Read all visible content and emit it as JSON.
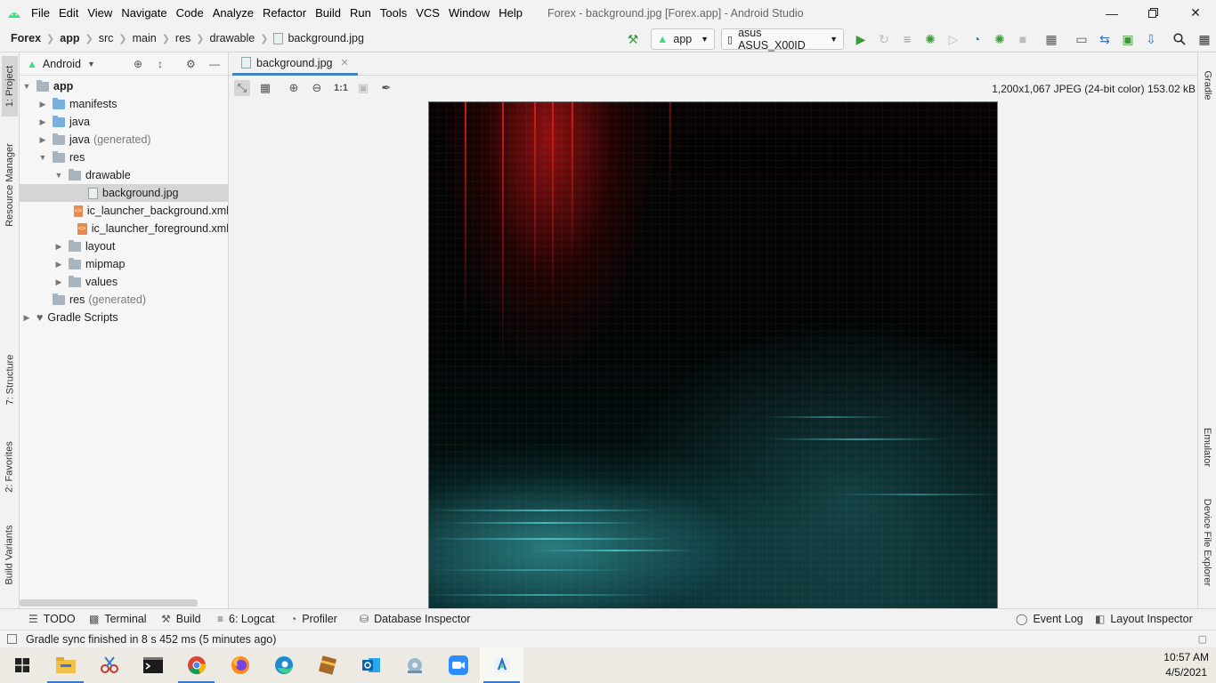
{
  "window": {
    "title": "Forex - background.jpg [Forex.app] - Android Studio",
    "menu": [
      "File",
      "Edit",
      "View",
      "Navigate",
      "Code",
      "Analyze",
      "Refactor",
      "Build",
      "Run",
      "Tools",
      "VCS",
      "Window",
      "Help"
    ]
  },
  "breadcrumb": [
    "Forex",
    "app",
    "src",
    "main",
    "res",
    "drawable",
    "background.jpg"
  ],
  "run_config": {
    "module": "app",
    "device": "asus ASUS_X00ID"
  },
  "left_strip": [
    "1: Project",
    "Resource Manager",
    "7: Structure",
    "2: Favorites",
    "Build Variants"
  ],
  "right_strip": [
    "Gradle",
    "Emulator",
    "Device File Explorer"
  ],
  "project_panel": {
    "view_mode": "Android",
    "tree": [
      {
        "label": "app",
        "bold": true,
        "depth": 0
      },
      {
        "label": "manifests",
        "depth": 1
      },
      {
        "label": "java",
        "depth": 1
      },
      {
        "label": "java",
        "suffix": "(generated)",
        "depth": 1
      },
      {
        "label": "res",
        "depth": 1
      },
      {
        "label": "drawable",
        "depth": 2
      },
      {
        "label": "background.jpg",
        "depth": 3,
        "selected": true
      },
      {
        "label": "ic_launcher_background.xml",
        "depth": 3
      },
      {
        "label": "ic_launcher_foreground.xml",
        "depth": 3
      },
      {
        "label": "layout",
        "depth": 2
      },
      {
        "label": "mipmap",
        "depth": 2
      },
      {
        "label": "values",
        "depth": 2
      },
      {
        "label": "res",
        "suffix": "(generated)",
        "depth": 1
      },
      {
        "label": "Gradle Scripts",
        "depth": 0
      }
    ]
  },
  "editor": {
    "tab": "background.jpg",
    "zoom_label": "1:1",
    "image_info": "1,200x1,067 JPEG (24-bit color) 153.02 kB"
  },
  "bottom_tabs": [
    "TODO",
    "Terminal",
    "Build",
    "6: Logcat",
    "Profiler",
    "Database Inspector",
    "Event Log",
    "Layout Inspector"
  ],
  "status": "Gradle sync finished in 8 s 452 ms (5 minutes ago)",
  "clock": {
    "time": "10:57 AM",
    "date": "4/5/2021"
  },
  "colors": {
    "accent": "#4083c9",
    "selection": "#d5d5d5",
    "run_green": "#3c9a3c"
  }
}
